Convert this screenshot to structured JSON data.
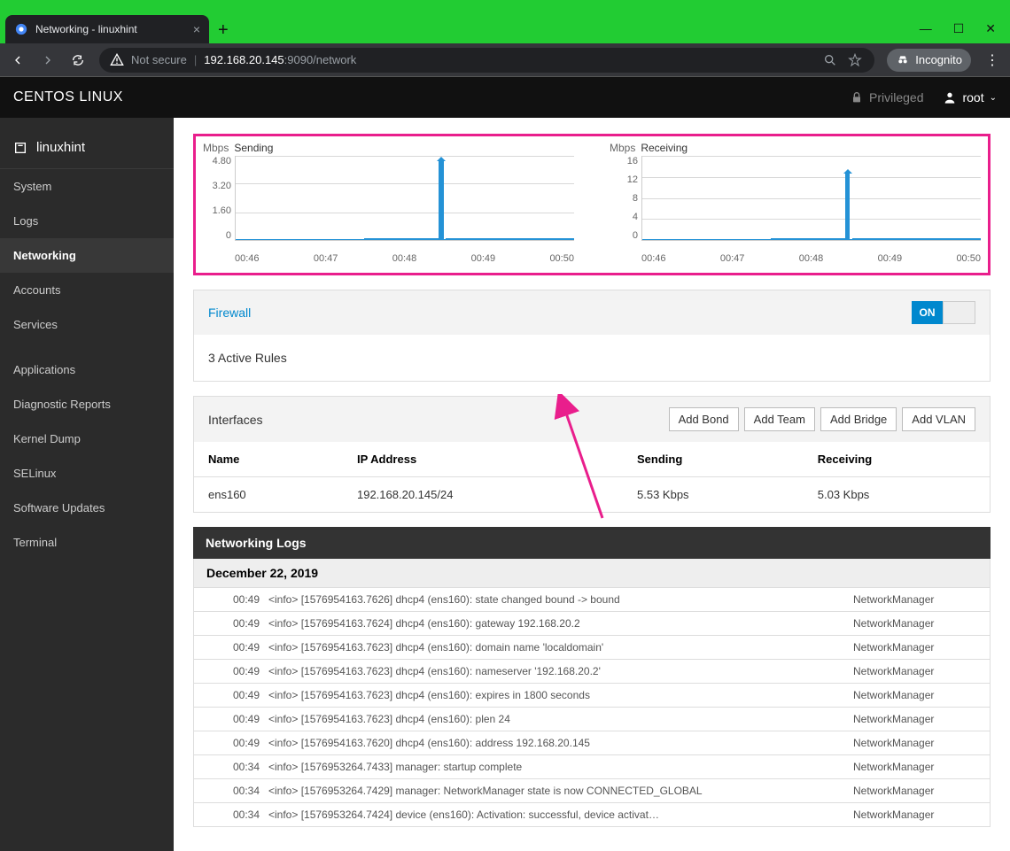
{
  "browser": {
    "tab_title": "Networking - linuxhint",
    "not_secure": "Not secure",
    "addr_ip": "192.168.20.145",
    "addr_port_path": ":9090/network",
    "incognito": "Incognito"
  },
  "cockpit": {
    "brand": "CENTOS LINUX",
    "priv": "Privileged",
    "user": "root"
  },
  "sidebar": {
    "host": "linuxhint",
    "items": [
      "System",
      "Logs",
      "Networking",
      "Accounts",
      "Services",
      "Applications",
      "Diagnostic Reports",
      "Kernel Dump",
      "SELinux",
      "Software Updates",
      "Terminal"
    ],
    "active_index": 2
  },
  "chart_data": [
    {
      "type": "line",
      "title": "Sending",
      "unit": "Mbps",
      "y_ticks": [
        "4.80",
        "3.20",
        "1.60",
        "0"
      ],
      "x_ticks": [
        "00:46",
        "00:47",
        "00:48",
        "00:49",
        "00:50"
      ],
      "ylim": [
        0,
        4.8
      ],
      "peak": {
        "time": "00:49",
        "value": 4.6
      }
    },
    {
      "type": "line",
      "title": "Receiving",
      "unit": "Mbps",
      "y_ticks": [
        "16",
        "12",
        "8",
        "4",
        "0"
      ],
      "x_ticks": [
        "00:46",
        "00:47",
        "00:48",
        "00:49",
        "00:50"
      ],
      "ylim": [
        0,
        16
      ],
      "peak": {
        "time": "00:49",
        "value": 13
      }
    }
  ],
  "firewall": {
    "link": "Firewall",
    "toggle": "ON",
    "rules_text": "3 Active Rules"
  },
  "interfaces": {
    "title": "Interfaces",
    "buttons": [
      "Add Bond",
      "Add Team",
      "Add Bridge",
      "Add VLAN"
    ],
    "columns": [
      "Name",
      "IP Address",
      "Sending",
      "Receiving"
    ],
    "rows": [
      {
        "name": "ens160",
        "ip": "192.168.20.145/24",
        "sending": "5.53 Kbps",
        "receiving": "5.03 Kbps"
      }
    ]
  },
  "logs": {
    "title": "Networking Logs",
    "date": "December 22, 2019",
    "entries": [
      {
        "time": "00:49",
        "msg": "<info> [1576954163.7626] dhcp4 (ens160): state changed bound -> bound",
        "src": "NetworkManager"
      },
      {
        "time": "00:49",
        "msg": "<info> [1576954163.7624] dhcp4 (ens160): gateway 192.168.20.2",
        "src": "NetworkManager"
      },
      {
        "time": "00:49",
        "msg": "<info> [1576954163.7623] dhcp4 (ens160): domain name 'localdomain'",
        "src": "NetworkManager"
      },
      {
        "time": "00:49",
        "msg": "<info> [1576954163.7623] dhcp4 (ens160): nameserver '192.168.20.2'",
        "src": "NetworkManager"
      },
      {
        "time": "00:49",
        "msg": "<info> [1576954163.7623] dhcp4 (ens160): expires in 1800 seconds",
        "src": "NetworkManager"
      },
      {
        "time": "00:49",
        "msg": "<info> [1576954163.7623] dhcp4 (ens160): plen 24",
        "src": "NetworkManager"
      },
      {
        "time": "00:49",
        "msg": "<info> [1576954163.7620] dhcp4 (ens160): address 192.168.20.145",
        "src": "NetworkManager"
      },
      {
        "time": "00:34",
        "msg": "<info> [1576953264.7433] manager: startup complete",
        "src": "NetworkManager"
      },
      {
        "time": "00:34",
        "msg": "<info> [1576953264.7429] manager: NetworkManager state is now CONNECTED_GLOBAL",
        "src": "NetworkManager"
      },
      {
        "time": "00:34",
        "msg": "<info> [1576953264.7424] device (ens160): Activation: successful, device activat…",
        "src": "NetworkManager"
      }
    ]
  }
}
